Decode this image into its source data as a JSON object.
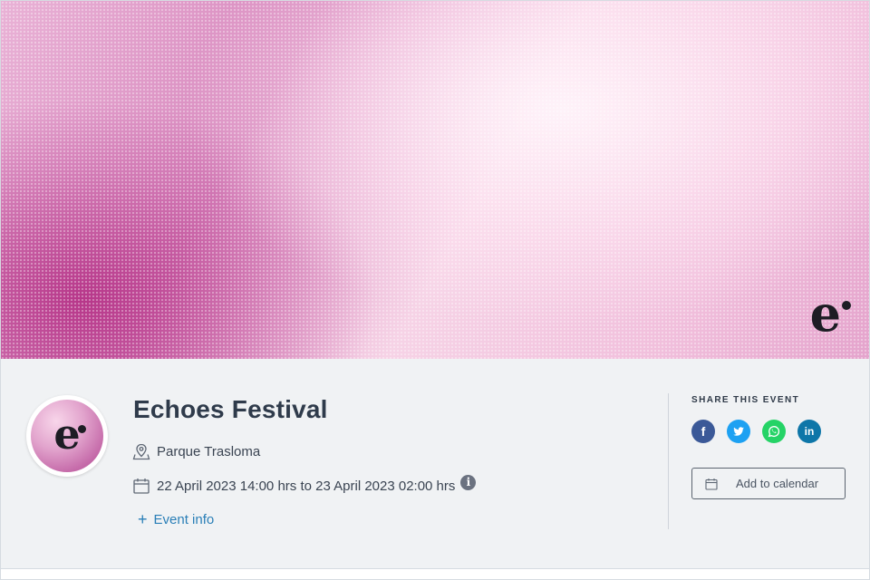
{
  "hero": {
    "logo_letter": "e"
  },
  "event": {
    "avatar_letter": "e",
    "title": "Echoes Festival",
    "location": "Parque Trasloma",
    "date_range": "22 April 2023 14:00 hrs to 23 April 2023 02:00 hrs",
    "info_icon_glyph": "i",
    "event_info_label": "Event info"
  },
  "share": {
    "title": "SHARE THIS EVENT",
    "icons": [
      {
        "name": "facebook-icon",
        "glyph": "f",
        "color": "#3b5998"
      },
      {
        "name": "twitter-icon",
        "glyph": "t",
        "color": "#1da1f2"
      },
      {
        "name": "whatsapp-icon",
        "glyph": "w",
        "color": "#25d366"
      },
      {
        "name": "linkedin-icon",
        "glyph": "in",
        "color": "#0e76a8"
      }
    ],
    "add_to_calendar_label": "Add to calendar"
  },
  "colors": {
    "accent_link": "#2a7fb7",
    "panel_bg": "#f0f2f4"
  }
}
